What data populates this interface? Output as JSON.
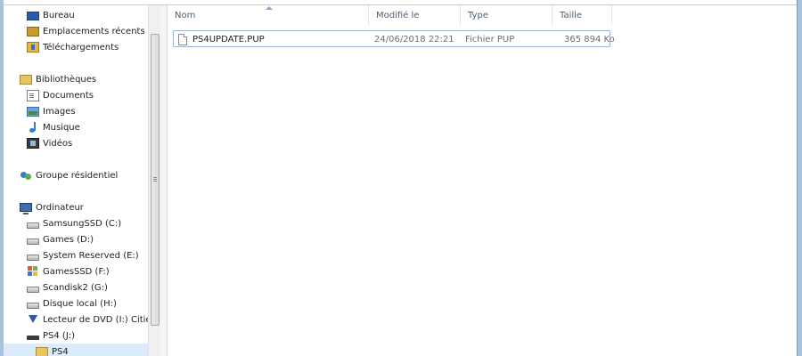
{
  "nav": {
    "items": [
      {
        "label": "Bureau",
        "icon": "desktop-icon"
      },
      {
        "label": "Emplacements récents",
        "icon": "recent-places-icon"
      },
      {
        "label": "Téléchargements",
        "icon": "downloads-icon"
      },
      {
        "label": "Bibliothèques",
        "icon": "libraries-icon"
      },
      {
        "label": "Documents",
        "icon": "documents-icon"
      },
      {
        "label": "Images",
        "icon": "images-icon"
      },
      {
        "label": "Musique",
        "icon": "music-icon"
      },
      {
        "label": "Vidéos",
        "icon": "videos-icon"
      },
      {
        "label": "Groupe résidentiel",
        "icon": "homegroup-icon"
      },
      {
        "label": "Ordinateur",
        "icon": "computer-icon"
      },
      {
        "label": "SamsungSSD (C:)",
        "icon": "drive-icon"
      },
      {
        "label": "Games (D:)",
        "icon": "drive-icon"
      },
      {
        "label": "System Reserved (E:)",
        "icon": "drive-icon"
      },
      {
        "label": "GamesSSD (F:)",
        "icon": "windows-drive-icon"
      },
      {
        "label": "Scandisk2 (G:)",
        "icon": "drive-icon"
      },
      {
        "label": "Disque local (H:)",
        "icon": "drive-icon"
      },
      {
        "label": "Lecteur de DVD (I:) Cities",
        "icon": "dvd-drive-icon"
      },
      {
        "label": "PS4 (J:)",
        "icon": "usb-drive-icon"
      },
      {
        "label": "PS4",
        "icon": "folder-icon"
      }
    ]
  },
  "columns": {
    "name": "Nom",
    "modified": "Modifié le",
    "type": "Type",
    "size": "Taille"
  },
  "files": [
    {
      "name": "PS4UPDATE.PUP",
      "modified": "24/06/2018 22:21",
      "type": "Fichier PUP",
      "size": "365 894 Ko"
    }
  ],
  "colors": {
    "selection": "#dcebfc",
    "header_text": "#4c607a",
    "row_border": "#9bb6d6"
  }
}
